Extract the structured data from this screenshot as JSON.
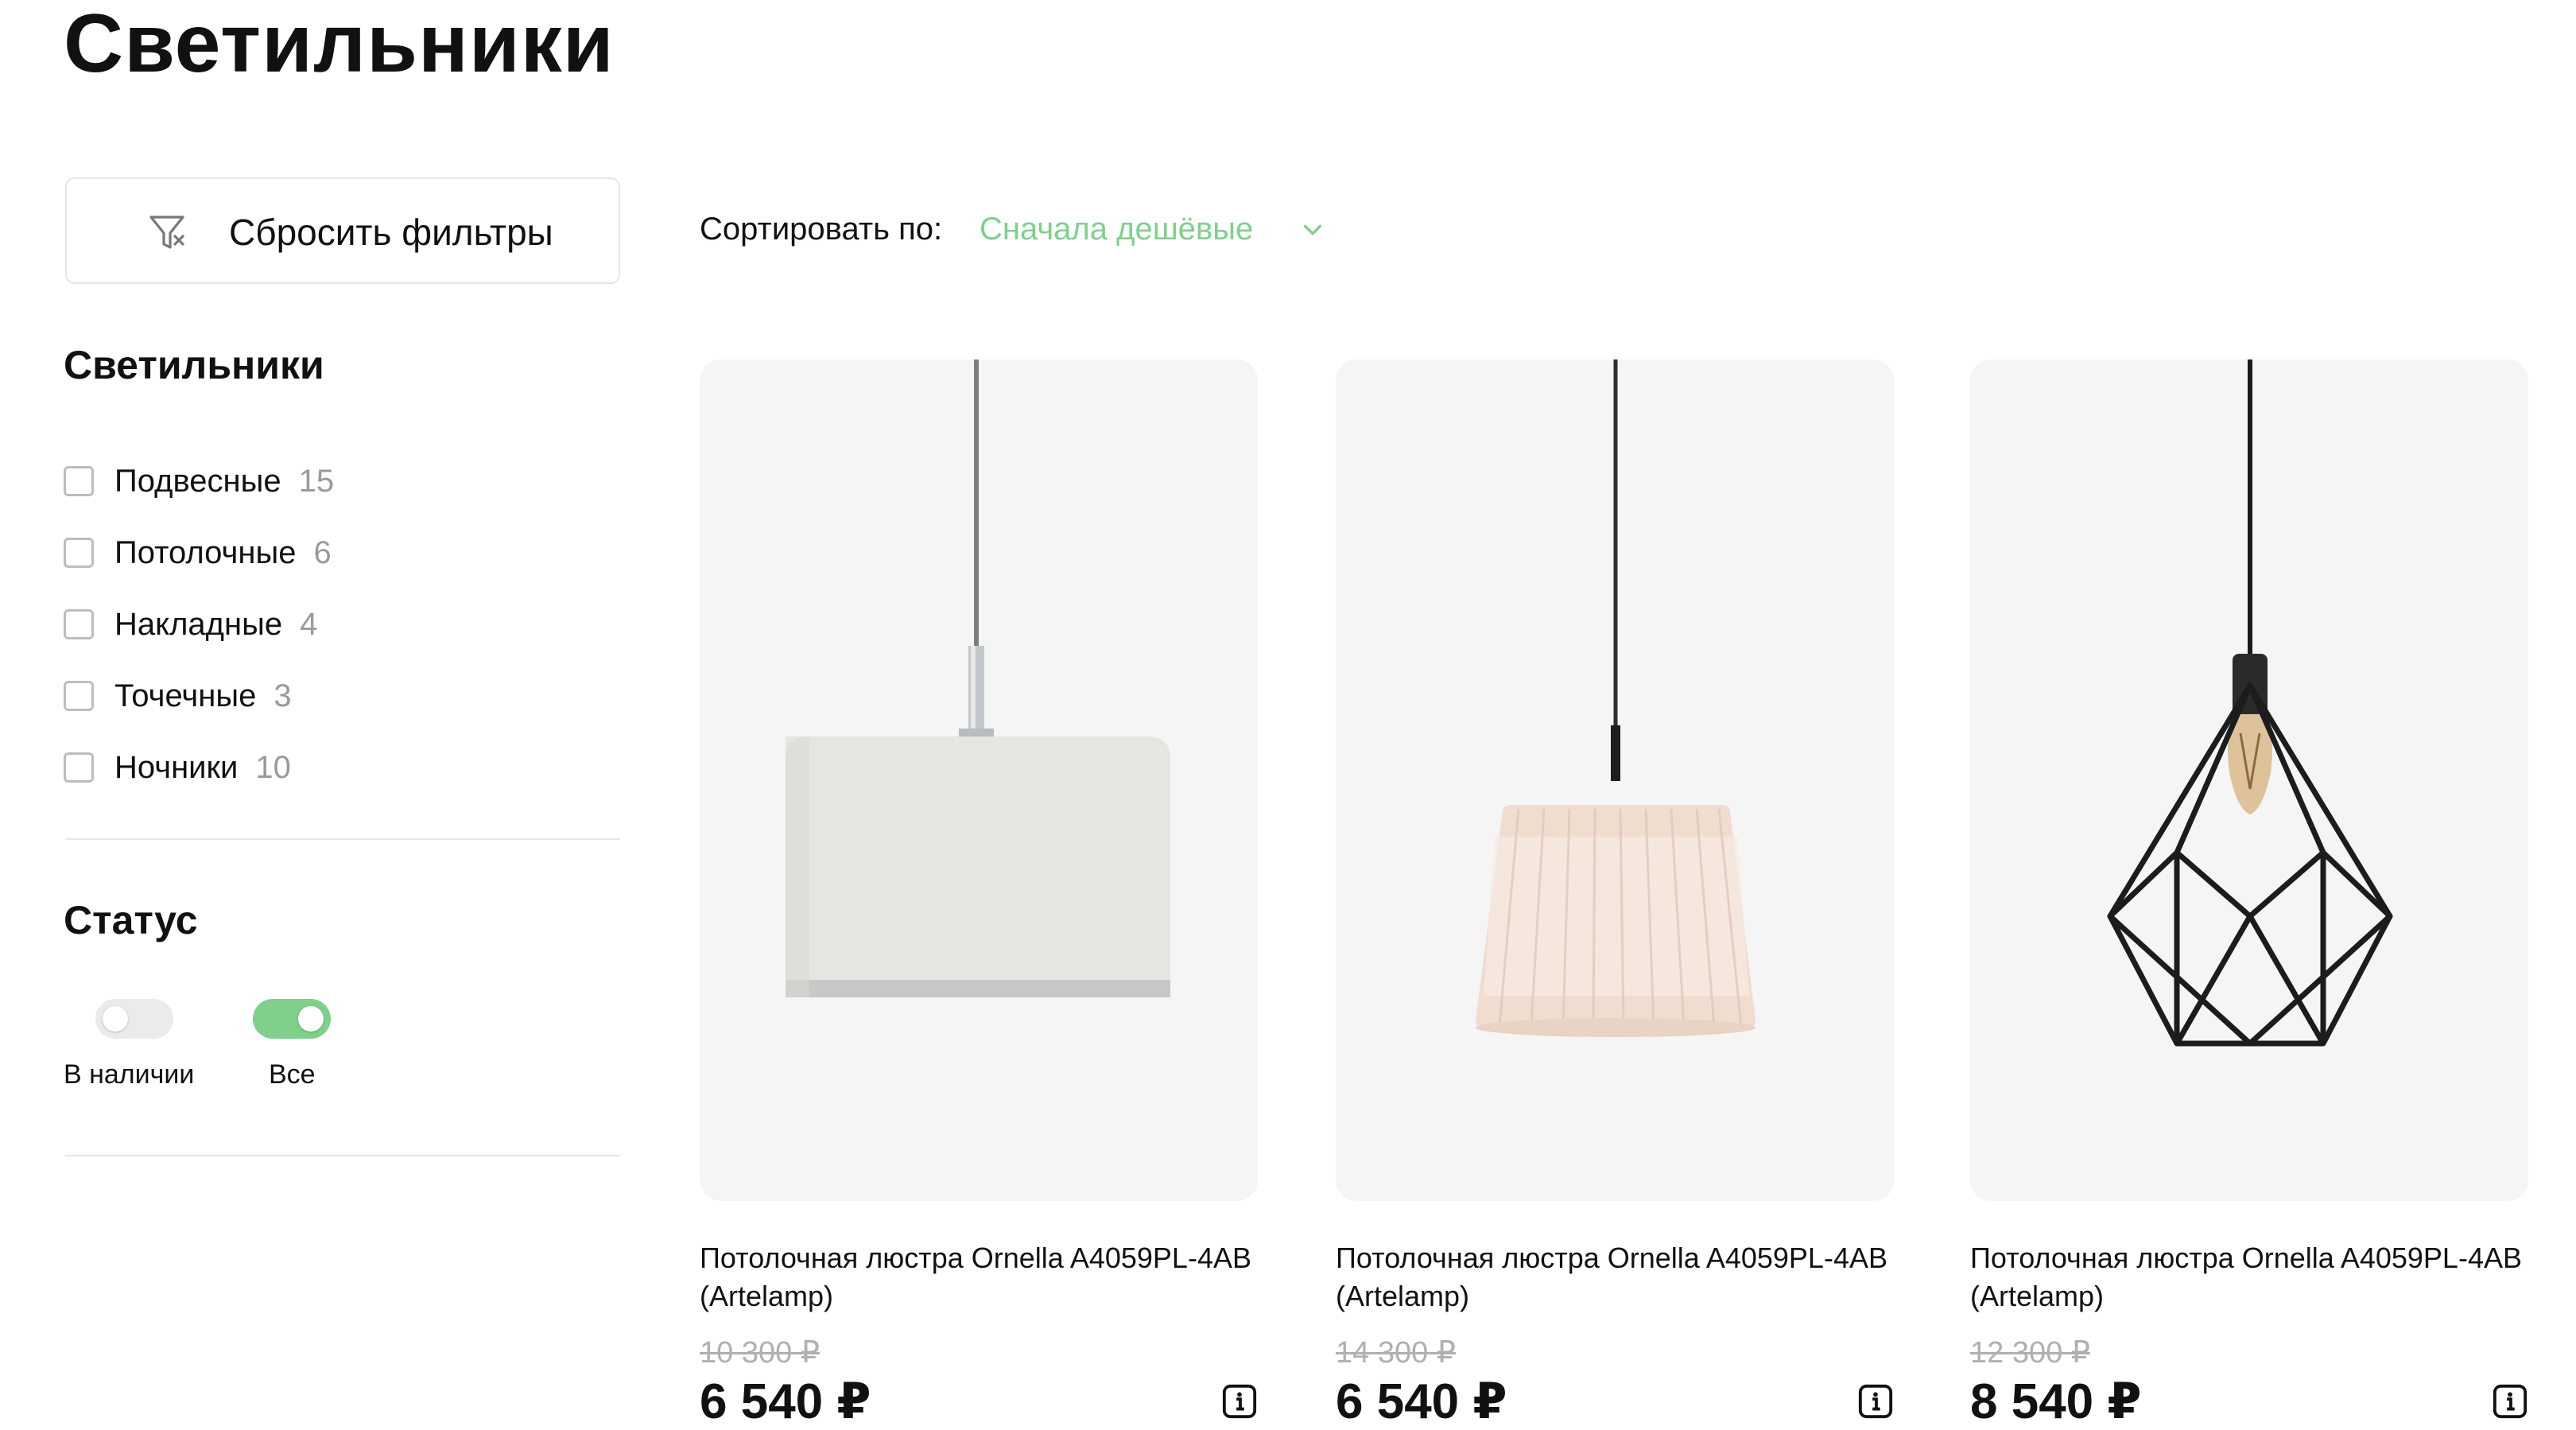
{
  "page": {
    "title": "Светильники"
  },
  "sidebar": {
    "reset_label": "Сбросить фильтры",
    "types_title": "Светильники",
    "types": [
      {
        "label": "Подвесные",
        "count": "15"
      },
      {
        "label": "Потолочные",
        "count": "6"
      },
      {
        "label": "Накладные",
        "count": "4"
      },
      {
        "label": "Точечные",
        "count": "3"
      },
      {
        "label": "Ночники",
        "count": "10"
      }
    ],
    "status_title": "Статус",
    "status_toggles": [
      {
        "label": "В наличии",
        "on": false
      },
      {
        "label": "Все",
        "on": true
      }
    ]
  },
  "sort": {
    "label": "Сортировать по:",
    "value": "Сначала дешёвые"
  },
  "products": [
    {
      "name": "Потолочная люстра Ornella A4059PL-4AB (Artelamp)",
      "old_price": "10 300 ₽",
      "price": "6 540 ₽",
      "image": "drum-shade-lamp"
    },
    {
      "name": "Потолочная люстра Ornella A4059PL-4AB (Artelamp)",
      "old_price": "14 300 ₽",
      "price": "6 540 ₽",
      "image": "pleated-shade-lamp"
    },
    {
      "name": "Потолочная люстра Ornella A4059PL-4AB (Artelamp)",
      "old_price": "12 300 ₽",
      "price": "8 540 ₽",
      "image": "geometric-cage-lamp"
    }
  ],
  "colors": {
    "accent": "#7fd08b",
    "toggle_off": "#ebebeb",
    "card_bg": "#f5f5f5",
    "muted": "#9a9a9a"
  },
  "icons": {
    "reset": "filter-clear-icon",
    "sort": "chevron-down-icon",
    "info": "info-icon"
  }
}
